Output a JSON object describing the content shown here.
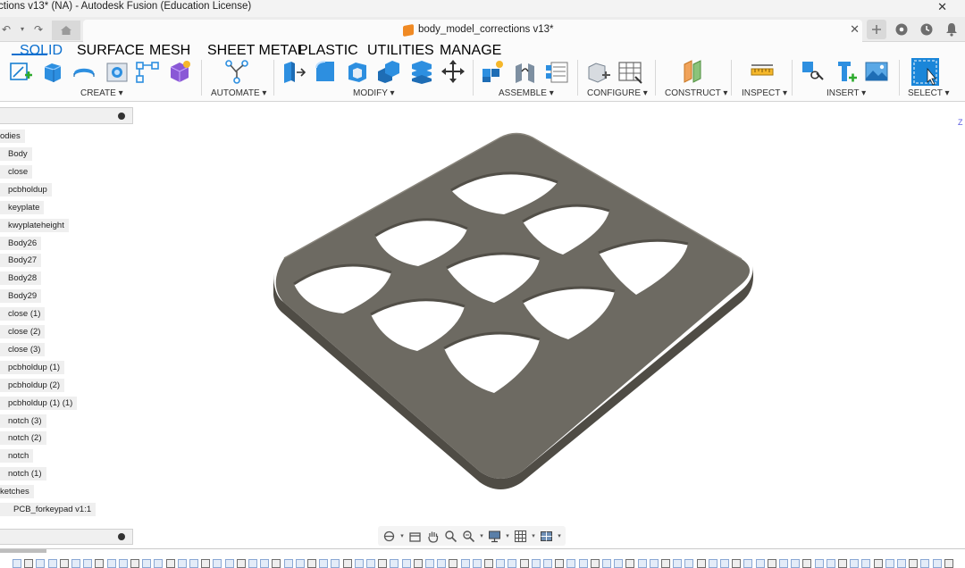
{
  "window": {
    "title": "ctions v13* (NA) - Autodesk Fusion (Education License)",
    "close_label": "✕"
  },
  "document_tab": {
    "title": "body_model_corrections v13*",
    "close_label": "✕"
  },
  "workspace_tabs": [
    "SOLID",
    "SURFACE",
    "MESH",
    "SHEET METAL",
    "PLASTIC",
    "UTILITIES",
    "MANAGE"
  ],
  "active_workspace_tab": "SOLID",
  "ribbon_groups": {
    "create": "CREATE ▾",
    "automate": "AUTOMATE ▾",
    "modify": "MODIFY ▾",
    "assemble": "ASSEMBLE ▾",
    "configure": "CONFIGURE ▾",
    "construct": "CONSTRUCT ▾",
    "inspect": "INSPECT ▾",
    "insert": "INSERT ▾",
    "select": "SELECT ▾"
  },
  "browser": {
    "bodies_folder": "odies",
    "bodies": [
      "Body",
      "close",
      "pcbholdup",
      "keyplate",
      "kwyplateheight",
      "Body26",
      "Body27",
      "Body28",
      "Body29",
      "close (1)",
      "close (2)",
      "close (3)",
      "pcbholdup (1)",
      "pcbholdup (2)",
      "pcbholdup (1) (1)",
      "notch (3)",
      "notch (2)",
      "notch",
      "notch (1)"
    ],
    "sketches_folder": "ketches",
    "sketch_item": "PCB_forkeypad v1:1"
  },
  "viewcube_edge_label": "Z",
  "colors": {
    "accent": "#0b6fcf",
    "model_top": "#6f6b63",
    "model_side": "#56534c",
    "ribbon_bg": "#fbfbfb"
  }
}
